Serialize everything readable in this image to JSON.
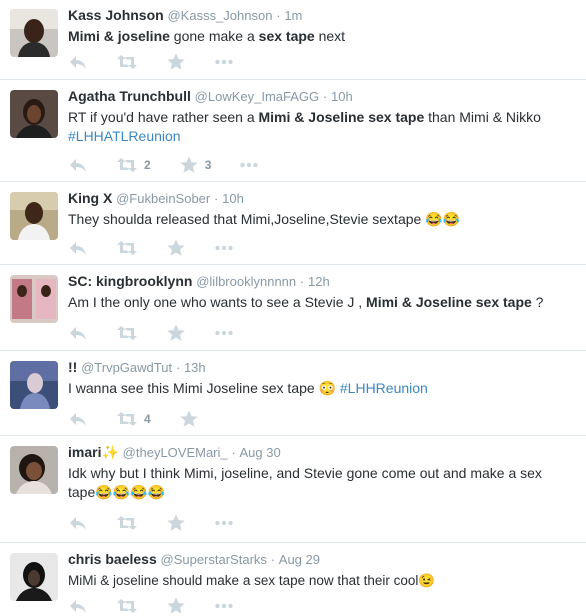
{
  "colors": {
    "icon": "#ccd6dd",
    "link": "#3b88c3",
    "muted": "#8899a6",
    "divider": "#e1e8ed",
    "text": "#292f33"
  },
  "icons": {
    "reply": "reply-icon",
    "retweet": "retweet-icon",
    "favorite": "star-icon",
    "more": "more-icon"
  },
  "tweets": [
    {
      "fullname": "Kass Johnson",
      "username": "@Kasss_Johnson",
      "dot": "·",
      "time": "1m",
      "text": {
        "p1": "Mimi & joseline",
        "p2": " gone make a ",
        "p3": "sex tape",
        "p4": " next"
      },
      "retweets": "",
      "favorites": ""
    },
    {
      "fullname": "Agatha Trunchbull",
      "username": "@LowKey_ImaFAGG",
      "dot": "·",
      "time": "10h",
      "text": {
        "p1": "RT if you'd have rather seen a ",
        "p2": "Mimi & Joseline sex tape",
        "p3": " than Mimi & Nikko",
        "p4": "#LHHATLReunion"
      },
      "retweets": "2",
      "favorites": "3"
    },
    {
      "fullname": "King X",
      "username": "@FukbeinSober",
      "dot": "·",
      "time": "10h",
      "text": {
        "p1": "They shoulda released that Mimi,Joseline,Stevie sextape 😂😂"
      },
      "retweets": "",
      "favorites": ""
    },
    {
      "fullname": "SC: kingbrooklynn",
      "username": "@lilbrooklynnnnn",
      "dot": "·",
      "time": "12h",
      "text": {
        "p1": "Am I the only one who wants to see a Stevie J , ",
        "p2": "Mimi & Joseline sex tape",
        "p3": " ?"
      },
      "retweets": "",
      "favorites": ""
    },
    {
      "fullname": "!!",
      "username": "@TrvpGawdTut",
      "dot": "·",
      "time": "13h",
      "text": {
        "p1": "I wanna see this Mimi Joseline sex tape 😳 ",
        "p2": "#LHHReunion"
      },
      "retweets": "4",
      "favorites": ""
    },
    {
      "fullname": "imari✨",
      "username": "@theyLOVEMari_",
      "dot": "·",
      "time": "Aug 30",
      "text": {
        "p1": "Idk why but I think Mimi, joseline, and Stevie gone come out and make a sex tape😂😂😂😂"
      },
      "retweets": "",
      "favorites": ""
    },
    {
      "fullname": "chris baeless",
      "username": "@SuperstarStarks",
      "dot": "·",
      "time": "Aug 29",
      "text": {
        "p1": "MiMi & joseline should make a sex tape now that their cool😉"
      },
      "retweets": "",
      "favorites": ""
    }
  ]
}
